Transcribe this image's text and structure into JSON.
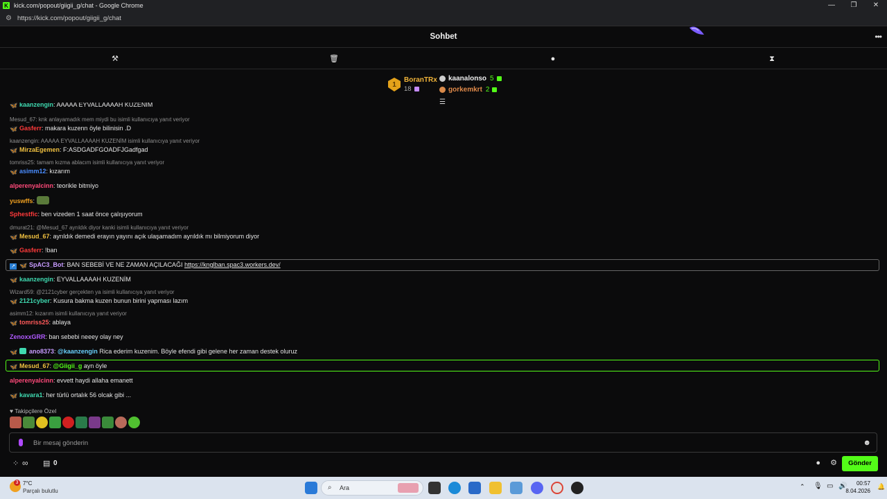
{
  "window": {
    "title": "kick.com/popout/giigii_g/chat - Google Chrome",
    "url": "https://kick.com/popout/giigii_g/chat",
    "controls": [
      "—",
      "❐",
      "✕"
    ]
  },
  "header": {
    "title": "Sohbet",
    "more": "•••"
  },
  "leaderboard": {
    "rank1": {
      "rank": "1",
      "name": "BoranTRx",
      "count": "18"
    },
    "rank2": {
      "name": "kaanalonso",
      "count": "5"
    },
    "rank3": {
      "name": "gorkemkrt",
      "count": "2"
    }
  },
  "chat": {
    "top_partial": {
      "user": "kaanzengin",
      "text": ": AAAAA EYVALLAAAAH KUZENİM"
    },
    "messages": [
      {
        "reply": "Mesud_67: knk anlayamadık mem miydi bu isimli kullanıcıya yanıt veriyor",
        "user": "Gasferr",
        "text": ": makara kuzenn öyle bilinisin .D"
      },
      {
        "reply": "kaanzengin: AAAAA EYVALLAAAAH KUZENİM isimli kullanıcıya yanıt veriyor",
        "user": "MirzaEgemen",
        "text": ": F:ASDGADFGOADFJGadfgad"
      },
      {
        "reply": "tomriss25: tamam kızma ablacım isimli kullanıcıya yanıt veriyor",
        "user": "asimm12",
        "text": ": kızarım"
      },
      {
        "user": "alperenyalcinn",
        "text": ": teorikle bitmiyo"
      },
      {
        "user": "yuswffs",
        "text": ":"
      },
      {
        "user": "Sphestfic",
        "text": ": ben vizeden 1 saat önce çalışıyorum"
      },
      {
        "reply": "dmurat21: @Mesud_67 ayrıldık diyor kanki isimli kullanıcıya yanıt veriyor",
        "user": "Mesud_67",
        "text": ": ayrıldık demedi erayın yayını açık ulaşamadım ayrıldık mı bilmiyorum diyor"
      },
      {
        "user": "Gasferr",
        "text": ": !ban"
      },
      {
        "user": "SpAC3_Bot",
        "text": ": BAN SEBEBİ VE NE ZAMAN AÇILACAĞI ",
        "link": "https://knglban.spac3.workers.dev/"
      },
      {
        "user": "kaanzengin",
        "text": ": EYVALLAAAAH KUZENİM"
      },
      {
        "reply": "Wizard59: @2121cyber gerçekten ya isimli kullanıcıya yanıt veriyor",
        "user": "2121cyber",
        "text": ": Kusura bakma kuzen bunun birini yapması lazım"
      },
      {
        "reply": "asimm12: kızarım isimli kullanıcıya yanıt veriyor",
        "user": "tomriss25",
        "text": ": ablaya"
      },
      {
        "user": "ZenoxxGRR",
        "text": ": ban sebebi neeey olay ney"
      },
      {
        "user": "ano8373",
        "mention": "@kaanzengin",
        "text": " Rica ederim kuzenim. Böyle efendi gibi gelene her zaman destek oluruz"
      },
      {
        "user": "Mesud_67",
        "mention": "@Giigii_g",
        "text": " ayn öyle"
      },
      {
        "user": "alperenyalcinn",
        "text": ": evvett haydi allaha emanett"
      },
      {
        "user": "kavara1",
        "text": ": her türlü ortalık 56 olcak gibi ..."
      }
    ]
  },
  "followers_label": "Takipçilere Özel",
  "input": {
    "placeholder": "Bir mesaj gönderin"
  },
  "bottom": {
    "points": "0",
    "infinity": "∞",
    "send_label": "Gönder"
  },
  "taskbar": {
    "weather_temp": "7°C",
    "weather_desc": "Parçalı bulutlu",
    "weather_badge": "3",
    "search_label": "Ara",
    "time": "00:57",
    "date": "8.04.2026"
  }
}
